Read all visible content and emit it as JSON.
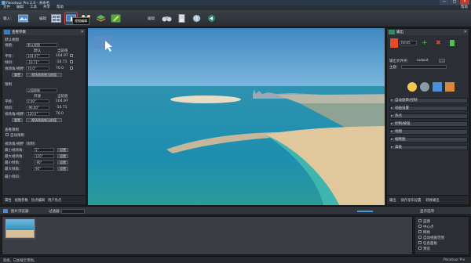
{
  "window": {
    "title": "Panotour Pro 2.0 - 未命名",
    "buttons": [
      "—",
      "□",
      "✕"
    ]
  },
  "menu": {
    "items": [
      "文件",
      "编辑",
      "工具",
      "共享",
      "帮助"
    ],
    "help": "帮助"
  },
  "toolbar": {
    "input_label": "输入：",
    "edit_label": "编辑",
    "build_label": "编辑",
    "tooltip": "视图编辑",
    "colors": {
      "selected_outline": "#e23b3b"
    }
  },
  "left_panel": {
    "title": "查看参数",
    "section1_title": "默认视图",
    "sub_label": "视图：",
    "sub_value": "默认视图",
    "col_default": "默认",
    "col_current": "当前值",
    "rows": [
      {
        "label": "平移：",
        "value": "104.97°",
        "current": "104.97"
      },
      {
        "label": "倾斜：",
        "value": "-10.71°",
        "current": "-10.71"
      },
      {
        "label": "视场角/视野：",
        "value": "70.0°",
        "current": "70.0"
      }
    ],
    "buttons": [
      "重置",
      "视场角限制当前值"
    ],
    "section2_title": "限制",
    "section2_value": "以值限制",
    "limit_col_max": "开放",
    "limit_col_current": "当前值",
    "limit_rows": [
      {
        "label": "平移：",
        "value": "0.00°",
        "current": "104.97"
      },
      {
        "label": "倾斜：",
        "value": "-90.00°",
        "current": "-10.71"
      },
      {
        "label": "视场角/视野：",
        "value": "120.0°",
        "current": "70.0"
      }
    ],
    "limit_buttons": [
      "重置",
      "视场角限制当前值"
    ],
    "section3_title": "查看限制",
    "section3_check": "自动限制",
    "section4_title": "视场角/视野（限制）",
    "s4_rows": [
      {
        "label": "最小视场角：",
        "value": "5°",
        "extra": "设置"
      },
      {
        "label": "最大视场角：",
        "value": "120°",
        "extra": "设置"
      },
      {
        "label": "最小倾角：",
        "value": "-90°",
        "extra": "设置"
      },
      {
        "label": "最大倾角：",
        "value": "90°",
        "extra": "设置"
      }
    ],
    "s4_sub": "最小倾斜：",
    "tabs": [
      "属性",
      "视图参数",
      "热点编辑",
      "用户热点"
    ]
  },
  "right_panel": {
    "title": "输出",
    "format_value": "html5",
    "output_folder_label": "输出文件夹：",
    "output_folder_value": "output",
    "theme_label": "主题：",
    "sections": [
      "自动旋转/控制",
      "动画设置",
      "热点",
      "控制/按钮",
      "地图",
      "缩略图",
      "高级"
    ],
    "tabs": [
      "输出",
      "保存发布设置",
      "转换输出"
    ]
  },
  "bottom": {
    "left_title": "图片浏览器",
    "filter_label": "过滤器：",
    "right_title": "显示选项",
    "options": [
      "蓝图",
      "中心点",
      "网格",
      "自动视图范围",
      "信息面板",
      "预览"
    ]
  },
  "status": {
    "left": "就绪，已加载全景图。",
    "right": "Panotour Pro"
  }
}
